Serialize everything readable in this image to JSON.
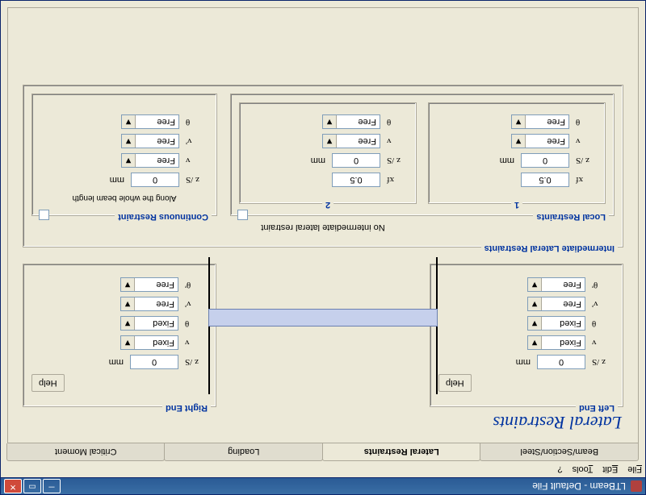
{
  "window": {
    "title": "LTBeam - Default File"
  },
  "menu": {
    "file": "File",
    "edit": "Edit",
    "tools": "Tools",
    "help": "?"
  },
  "tabs": {
    "t1": "Beam/Section/Steel",
    "t2": "Lateral Restraints",
    "t3": "Loading",
    "t4": "Critical Moment"
  },
  "panel": {
    "title": "Lateral Restraints"
  },
  "help_label": "Help",
  "ends": {
    "left": {
      "legend": "Left End",
      "zs": {
        "label": "z /S",
        "value": "0",
        "unit": "mm"
      },
      "v": {
        "label": "v",
        "value": "Fixed"
      },
      "th": {
        "label": "θ",
        "value": "Fixed"
      },
      "vp": {
        "label": "v'",
        "value": "Free"
      },
      "thp": {
        "label": "θ'",
        "value": "Free"
      }
    },
    "right": {
      "legend": "Right End",
      "zs": {
        "label": "z /S",
        "value": "0",
        "unit": "mm"
      },
      "v": {
        "label": "v",
        "value": "Fixed"
      },
      "th": {
        "label": "θ",
        "value": "Fixed"
      },
      "vp": {
        "label": "v'",
        "value": "Free"
      },
      "thp": {
        "label": "θ'",
        "value": "Free"
      }
    }
  },
  "intermediate": {
    "legend": "Intermediate Lateral Restraints",
    "none_text": "No intermediate lateral restraint",
    "local": {
      "legend": "Local Restraints",
      "cols": [
        "1",
        "2"
      ],
      "items": {
        "xf": {
          "label": "xf",
          "c1": "0.5",
          "c2": "0.5"
        },
        "zs": {
          "label": "z /S",
          "c1": "0",
          "c2": "0",
          "unit": "mm"
        },
        "v": {
          "label": "v",
          "c1": "Free",
          "c2": "Free"
        },
        "th": {
          "label": "θ",
          "c1": "Free",
          "c2": "Free"
        }
      }
    },
    "continuous": {
      "legend": "Continuous Restraint",
      "note": "Along the whole beam length",
      "zs": {
        "label": "z /S",
        "value": "0",
        "unit": "mm"
      },
      "v": {
        "label": "v",
        "value": "Free"
      },
      "vp": {
        "label": "v'",
        "value": "Free"
      },
      "th": {
        "label": "θ",
        "value": "Free"
      }
    }
  }
}
